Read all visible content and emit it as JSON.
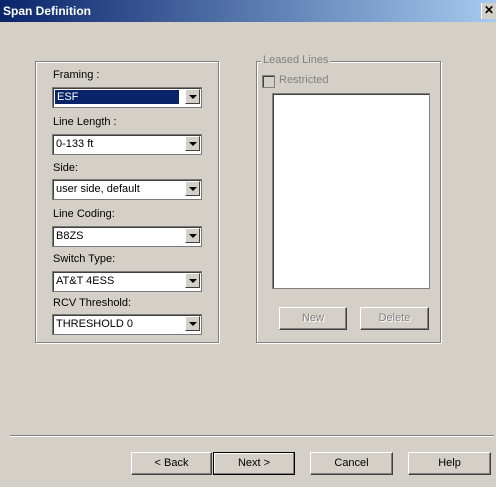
{
  "window": {
    "title": "Span Definition"
  },
  "fields": [
    {
      "label": "Framing :",
      "value": "ESF"
    },
    {
      "label": "Line Length :",
      "value": "0-133 ft"
    },
    {
      "label": "Side:",
      "value": "user side, default"
    },
    {
      "label": "Line Coding:",
      "value": "B8ZS"
    },
    {
      "label": "Switch Type:",
      "value": "AT&T 4ESS"
    },
    {
      "label": "RCV Threshold:",
      "value": "THRESHOLD 0"
    }
  ],
  "leased_lines": {
    "legend": "Leased Lines",
    "restricted_label": "Restricted",
    "new_label": "New",
    "delete_label": "Delete"
  },
  "footer": {
    "back_label": "< Back",
    "next_label": "Next >",
    "cancel_label": "Cancel",
    "help_label": "Help"
  }
}
